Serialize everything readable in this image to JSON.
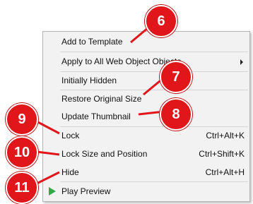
{
  "menu": {
    "items": [
      {
        "label": "Add to Template",
        "shortcut": ""
      },
      {
        "label": "Apply to All Web Object Objects",
        "shortcut": ""
      },
      {
        "label": "Initially Hidden",
        "shortcut": ""
      },
      {
        "label": "Restore Original Size",
        "shortcut": ""
      },
      {
        "label": "Update Thumbnail",
        "shortcut": ""
      },
      {
        "label": "Lock",
        "shortcut": "Ctrl+Alt+K"
      },
      {
        "label": "Lock Size and Position",
        "shortcut": "Ctrl+Shift+K"
      },
      {
        "label": "Hide",
        "shortcut": "Ctrl+Alt+H"
      },
      {
        "label": "Play Preview",
        "shortcut": ""
      }
    ],
    "submenu_arrow_icon": "chevron-right-icon",
    "play_icon": "play-icon"
  },
  "callouts": [
    {
      "number": "6"
    },
    {
      "number": "7"
    },
    {
      "number": "8"
    },
    {
      "number": "9"
    },
    {
      "number": "10"
    },
    {
      "number": "11"
    }
  ],
  "colors": {
    "callout_red": "#e0161b",
    "play_green": "#2eaa4a",
    "menu_background": "#f2f2f2"
  }
}
